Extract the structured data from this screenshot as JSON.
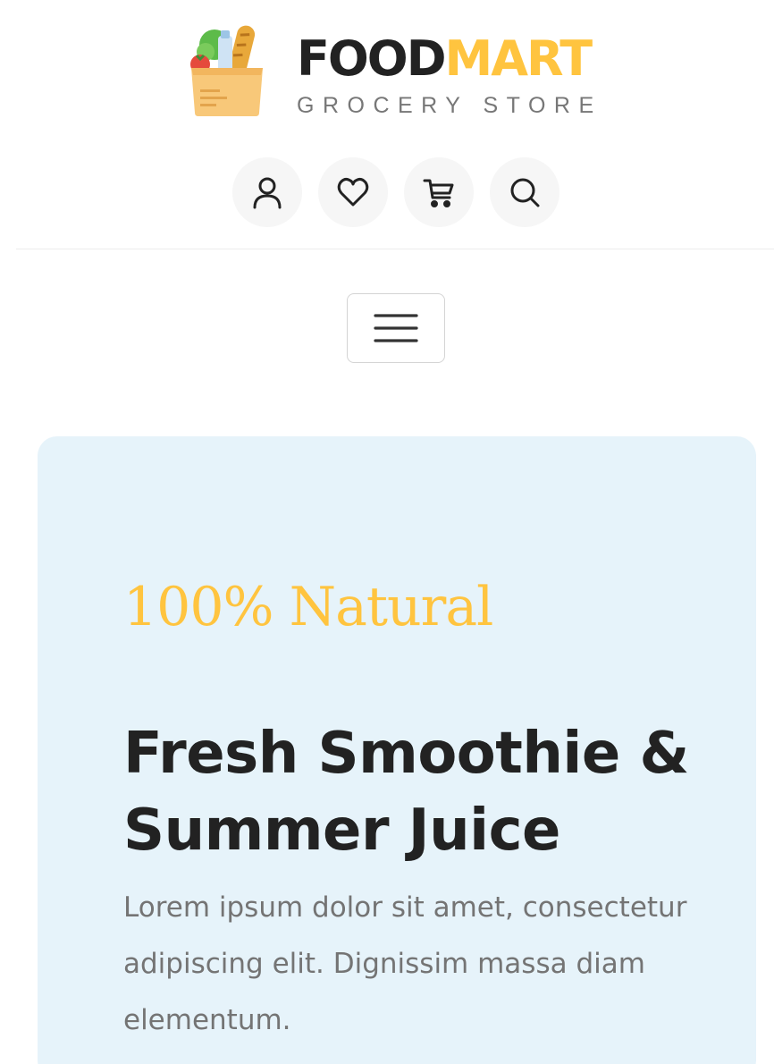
{
  "brand": {
    "name_part1": "FOOD",
    "name_part2": "MART",
    "tagline": "GROCERY STORE",
    "colors": {
      "accent": "#FFC43F",
      "dark": "#222222",
      "banner_bg": "#E6F3FA"
    }
  },
  "header": {
    "icons": [
      "user-icon",
      "heart-icon",
      "cart-icon",
      "search-icon"
    ]
  },
  "nav": {
    "toggler_icon": "hamburger-icon"
  },
  "banner": {
    "tagline": "100% Natural",
    "title": "Fresh Smoothie & Summer Juice",
    "text": "Lorem ipsum dolor sit amet, consectetur adipiscing elit. Dignissim massa diam elementum."
  }
}
